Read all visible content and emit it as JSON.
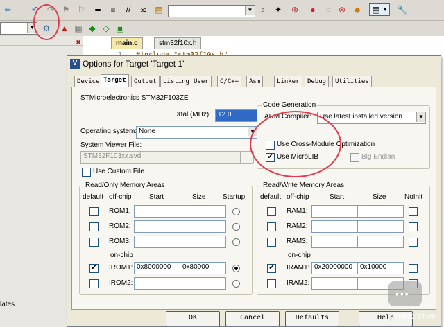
{
  "editor": {
    "tabs": [
      "main.c",
      "stm32f10x.h"
    ],
    "code_line_number": "1",
    "code_line": "#include \"stm32f10x.h\""
  },
  "left_panel": {
    "bottom_text": "lates"
  },
  "dialog": {
    "title": "Options for Target 'Target 1'",
    "tabs": [
      "Device",
      "Target",
      "Output",
      "Listing",
      "User",
      "C/C++",
      "Asm",
      "Linker",
      "Debug",
      "Utilities"
    ],
    "device_name": "STMicroelectronics STM32F103ZE",
    "xtal_label": "Xtal (MHz):",
    "xtal_value": "12.0",
    "os_label": "Operating system:",
    "os_value": "None",
    "svf_label": "System Viewer File:",
    "svf_value": "STM32F103xx.svd",
    "use_custom_file": "Use Custom File",
    "code_generation": {
      "title": "Code Generation",
      "compiler_label": "ARM Compiler:",
      "compiler_value": "Use latest installed version",
      "cross_module": "Use Cross-Module Optimization",
      "microlib": "Use MicroLIB",
      "big_endian": "Big Endian"
    },
    "rom": {
      "title": "Read/Only Memory Areas",
      "headers": [
        "default",
        "off-chip",
        "Start",
        "Size",
        "Startup"
      ],
      "on_chip_label": "on-chip",
      "rows": [
        {
          "name": "ROM1:",
          "start": "",
          "size": ""
        },
        {
          "name": "ROM2:",
          "start": "",
          "size": ""
        },
        {
          "name": "ROM3:",
          "start": "",
          "size": ""
        },
        {
          "name": "IROM1:",
          "start": "0x8000000",
          "size": "0x80000"
        },
        {
          "name": "IROM2:",
          "start": "",
          "size": ""
        }
      ]
    },
    "ram": {
      "title": "Read/Write Memory Areas",
      "headers": [
        "default",
        "off-chip",
        "Start",
        "Size",
        "NoInit"
      ],
      "on_chip_label": "on-chip",
      "rows": [
        {
          "name": "RAM1:",
          "start": "",
          "size": ""
        },
        {
          "name": "RAM2:",
          "start": "",
          "size": ""
        },
        {
          "name": "RAM3:",
          "start": "",
          "size": ""
        },
        {
          "name": "IRAM1:",
          "start": "0x20000000",
          "size": "0x10000"
        },
        {
          "name": "IRAM2:",
          "start": "",
          "size": ""
        }
      ]
    },
    "buttons": {
      "ok": "OK",
      "cancel": "Cancel",
      "defaults": "Defaults",
      "help": "Help"
    }
  },
  "watermark": "STM32/STM8",
  "colors": {
    "annotation": "#e53a4d",
    "accent": "#316ac5"
  }
}
